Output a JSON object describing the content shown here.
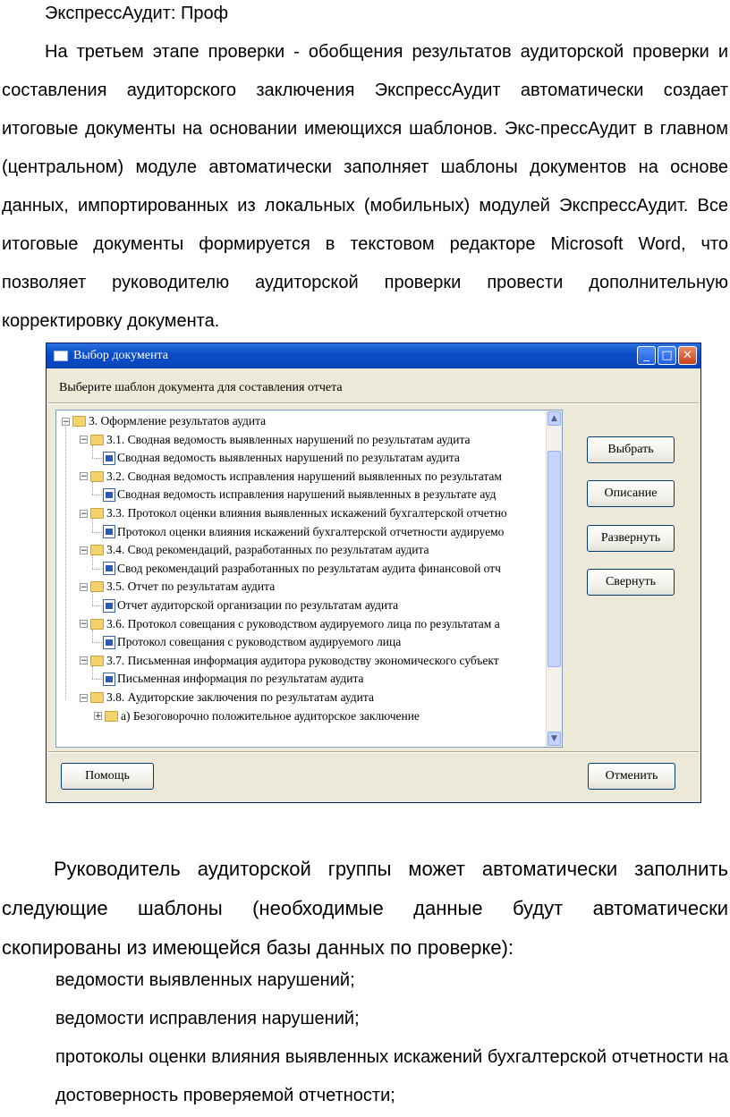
{
  "header": "ЭкспрессАудит: Проф",
  "paragraph1": "На третьем этапе проверки - обобщения результатов аудиторской проверки и составления аудиторского заключения ЭкспрессАудит автоматически создает итоговые документы на основании имеющихся шаблонов. Экс-прессАудит в главном (центральном) модуле автоматически заполняет шаблоны документов на основе данных, импортированных из локальных (мобильных) модулей ЭкспрессАудит. Все итоговые документы формируется в текстовом редакторе Microsoft Word, что позволяет руководителю аудиторской проверки провести дополнительную корректировку документа.",
  "dialog": {
    "title": "Выбор документа",
    "prompt": "Выберите шаблон документа для составления отчета",
    "buttons": {
      "select": "Выбрать",
      "description": "Описание",
      "expand": "Развернуть",
      "collapse": "Свернуть",
      "help": "Помощь",
      "cancel": "Отменить"
    },
    "tree": [
      {
        "level": 0,
        "kind": "folder",
        "exp": "−",
        "label": "3. Оформление результатов аудита"
      },
      {
        "level": 1,
        "kind": "folder",
        "exp": "−",
        "label": "3.1. Сводная ведомость выявленных нарушений по результатам аудита"
      },
      {
        "level": 2,
        "kind": "doc",
        "label": "Сводная ведомость выявленных нарушений по результатам аудита"
      },
      {
        "level": 1,
        "kind": "folder",
        "exp": "−",
        "label": "3.2. Сводная ведомость исправления нарушений выявленных по результатам"
      },
      {
        "level": 2,
        "kind": "doc",
        "label": "Сводная ведомость исправления нарушений выявленных в результате ауд"
      },
      {
        "level": 1,
        "kind": "folder",
        "exp": "−",
        "label": "3.3. Протокол оценки влияния выявленных искажений бухгалтерской отчетно"
      },
      {
        "level": 2,
        "kind": "doc",
        "label": "Протокол оценки влияния искажений бухгалтерской отчетности аудируемо"
      },
      {
        "level": 1,
        "kind": "folder",
        "exp": "−",
        "label": "3.4. Свод рекомендаций, разработанных по результатам аудита"
      },
      {
        "level": 2,
        "kind": "doc",
        "label": "Свод рекомендаций разработанных по результатам аудита финансовой отч"
      },
      {
        "level": 1,
        "kind": "folder",
        "exp": "−",
        "label": "3.5. Отчет по результатам аудита"
      },
      {
        "level": 2,
        "kind": "doc",
        "label": "Отчет аудиторской организации по результатам аудита"
      },
      {
        "level": 1,
        "kind": "folder",
        "exp": "−",
        "label": "3.6. Протокол совещания с руководством аудируемого лица по результатам а"
      },
      {
        "level": 2,
        "kind": "doc",
        "label": "Протокол совещания с руководством аудируемого лица"
      },
      {
        "level": 1,
        "kind": "folder",
        "exp": "−",
        "label": "3.7. Письменная информация аудитора руководству экономического субъект"
      },
      {
        "level": 2,
        "kind": "doc",
        "label": "Письменная информация по результатам аудита"
      },
      {
        "level": 1,
        "kind": "folder",
        "exp": "−",
        "label": "3.8. Аудиторские заключения по результатам аудита"
      },
      {
        "level": 2,
        "kind": "folder",
        "exp": "+",
        "label": "а) Безоговорочно положительное аудиторское заключение"
      }
    ]
  },
  "paragraph2": "Руководитель аудиторской группы может автоматически заполнить следующие шаблоны (необходимые данные будут автоматически скопированы из имеющейся базы данных по проверке):",
  "bullets": [
    "ведомости  выявленных  нарушений;",
    "ведомости исправления нарушений;",
    "протоколы оценки влияния выявленных искажений бухгалтерской отчетности на достоверность проверяемой отчетности;"
  ]
}
